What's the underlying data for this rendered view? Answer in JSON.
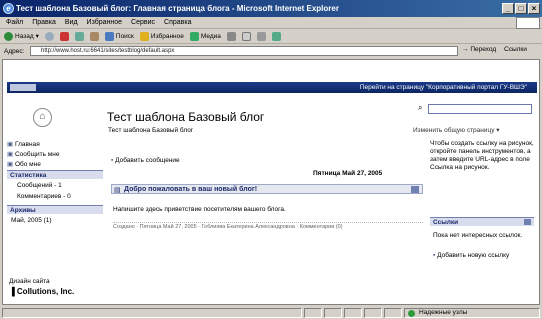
{
  "window": {
    "title": "Тест шаблона Базовый блог: Главная страница блога - Microsoft Internet Explorer"
  },
  "menu": [
    "Файл",
    "Правка",
    "Вид",
    "Избранное",
    "Сервис",
    "Справка"
  ],
  "toolbar": {
    "back": "Назад",
    "search": "Поиск",
    "favorites": "Избранное",
    "media": "Медиа"
  },
  "address": {
    "label": "Адрес:",
    "url": "http://www.host.ru:6641/sites/testblog/default.aspx",
    "go": "Переход",
    "links": "Ссылки"
  },
  "portal": {
    "links": "Перейти на страницу \"Корпоративный портал ГУ-ВШЭ\""
  },
  "site": {
    "title": "Тест шаблона Базовый блог",
    "breadcrumb": "Тест шаблона Базовый блог",
    "edit_page": "Изменить общую страницу ▾"
  },
  "sidebar": {
    "home": "Главная",
    "message": "Сообщить мне",
    "about": "Обо мне",
    "stats_header": "Статистика",
    "stats": [
      "Сообщений - 1",
      "Комментариев - 0"
    ],
    "archive_header": "Архивы",
    "archive": [
      "Май, 2005 (1)"
    ]
  },
  "post": {
    "add_message": "Добавить сообщение",
    "date": "Пятница Май 27, 2005",
    "title": "Добро пожаловать в ваш новый блог!",
    "body": "Напишите здесь приветствие посетителям вашего блога.",
    "footer": "Создано · Пятница Май 27, 2005 · Гоблиява Екатерина Александровна · Комментарии (0)"
  },
  "right": {
    "help": "Чтобы создать ссылку на рисунок, откройте панель инструментов, а затем введите URL-адрес в поле Ссылка на рисунок.",
    "help_bold": "Ссылка на рисунок.",
    "links_header": "Ссылки",
    "no_links": "Пока нет интересных ссылок.",
    "add_link": "Добавить новую ссылку"
  },
  "footer": {
    "design": "Дизайн сайта",
    "company": "Collutions, Inc."
  },
  "status": {
    "zone": "Надежные узлы"
  }
}
